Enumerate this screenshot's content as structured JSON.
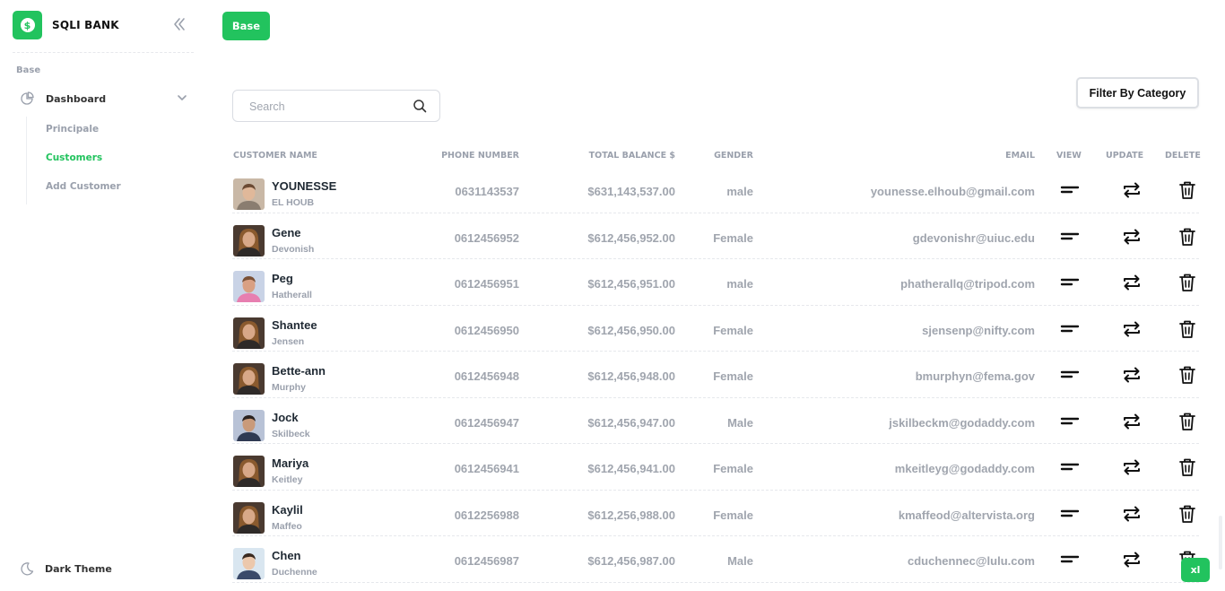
{
  "brand": {
    "name": "SQLI BANK",
    "logo_symbol": "$",
    "accent": "#22c35e"
  },
  "sidebar": {
    "section": "Base",
    "dashboard_label": "Dashboard",
    "subitems": [
      {
        "label": "Principale",
        "active": false
      },
      {
        "label": "Customers",
        "active": true
      },
      {
        "label": "Add Customer",
        "active": false
      }
    ],
    "dark_theme_label": "Dark Theme"
  },
  "header": {
    "badge": "Base"
  },
  "toolbar": {
    "search_placeholder": "Search",
    "search_value": "",
    "filter_label": "Filter By Category"
  },
  "table": {
    "columns": {
      "name": "CUSTOMER NAME",
      "phone": "PHONE NUMBER",
      "balance": "TOTAL BALANCE $",
      "gender": "GENDER",
      "email": "EMAIL",
      "view": "VIEW",
      "update": "UPDATE",
      "delete": "DELETE"
    },
    "rows": [
      {
        "first": "YOUNESSE",
        "last": "EL HOUB",
        "phone": "0631143537",
        "balance": "$631,143,537.00",
        "gender": "male",
        "email": "younesse.elhoub@gmail.com",
        "avatar": "man-light"
      },
      {
        "first": "Gene",
        "last": "Devonish",
        "phone": "0612456952",
        "balance": "$612,456,952.00",
        "gender": "Female",
        "email": "gdevonishr@uiuc.edu",
        "avatar": "woman"
      },
      {
        "first": "Peg",
        "last": "Hatherall",
        "phone": "0612456951",
        "balance": "$612,456,951.00",
        "gender": "male",
        "email": "phatherallq@tripod.com",
        "avatar": "man-pink"
      },
      {
        "first": "Shantee",
        "last": "Jensen",
        "phone": "0612456950",
        "balance": "$612,456,950.00",
        "gender": "Female",
        "email": "sjensenp@nifty.com",
        "avatar": "woman"
      },
      {
        "first": "Bette-ann",
        "last": "Murphy",
        "phone": "0612456948",
        "balance": "$612,456,948.00",
        "gender": "Female",
        "email": "bmurphyn@fema.gov",
        "avatar": "woman"
      },
      {
        "first": "Jock",
        "last": "Skilbeck",
        "phone": "0612456947",
        "balance": "$612,456,947.00",
        "gender": "Male",
        "email": "jskilbeckm@godaddy.com",
        "avatar": "man-dark"
      },
      {
        "first": "Mariya",
        "last": "Keitley",
        "phone": "0612456941",
        "balance": "$612,456,941.00",
        "gender": "Female",
        "email": "mkeitleyg@godaddy.com",
        "avatar": "woman"
      },
      {
        "first": "Kaylil",
        "last": "Maffeo",
        "phone": "0612256988",
        "balance": "$612,256,988.00",
        "gender": "Female",
        "email": "kmaffeod@altervista.org",
        "avatar": "woman"
      },
      {
        "first": "Chen",
        "last": "Duchenne",
        "phone": "0612456987",
        "balance": "$612,456,987.00",
        "gender": "Male",
        "email": "cduchennec@lulu.com",
        "avatar": "man-suit"
      }
    ]
  },
  "footer_badge": "xl"
}
